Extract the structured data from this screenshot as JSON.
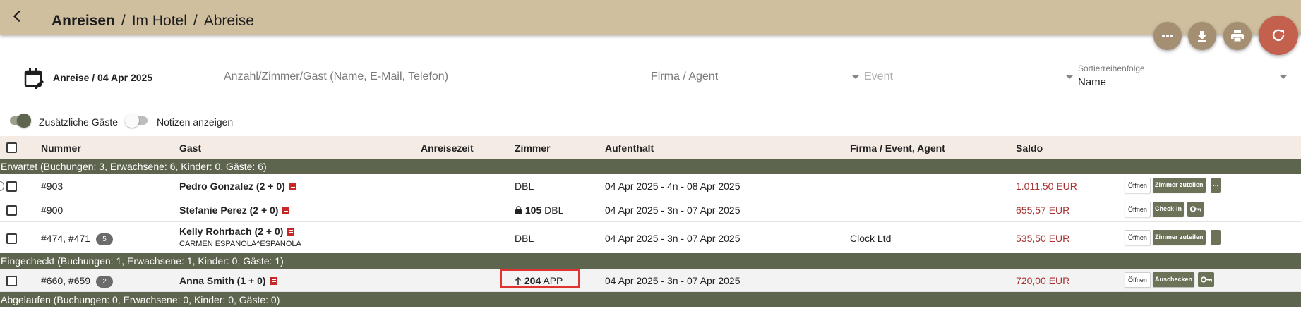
{
  "header": {
    "crumb_1": "Anreisen",
    "sep_1": "/",
    "crumb_2": "Im Hotel",
    "sep_2": "/",
    "crumb_3": "Abreise"
  },
  "actions": {
    "more": "more-icon",
    "download": "download-icon",
    "print": "print-icon",
    "refresh": "refresh-icon",
    "refresh_color": "#c4604e",
    "fab_color": "#a58f73"
  },
  "filters": {
    "arrival_label": "Anreise / 04 Apr 2025",
    "search_placeholder": "Anzahl/Zimmer/Gast (Name, E-Mail, Telefon)",
    "company_placeholder": "Firma / Agent",
    "event_placeholder": "Event",
    "sort_label": "Sortierreihenfolge",
    "sort_value": "Name"
  },
  "toggles": {
    "extra_guests": "Zusätzliche Gäste",
    "extra_guests_on": true,
    "show_notes": "Notizen anzeigen",
    "show_notes_on": false
  },
  "columns": {
    "number": "Nummer",
    "guest": "Gast",
    "arrival_time": "Anreisezeit",
    "room": "Zimmer",
    "stay": "Aufenthalt",
    "company": "Firma / Event, Agent",
    "balance": "Saldo"
  },
  "groups": {
    "expected": "Erwartet (Buchungen: 3, Erwachsene: 6, Kinder: 0, Gäste: 6)",
    "checked_in": "Eingecheckt (Buchungen: 1, Erwachsene: 1, Kinder: 0, Gäste: 1)",
    "expired": "Abgelaufen (Buchungen: 0, Erwachsene: 0, Kinder: 0, Gäste: 0)"
  },
  "rows": [
    {
      "number": "#903",
      "guest": "Pedro Gonzalez (2 + 0)",
      "room_no": "",
      "room_type": "DBL",
      "stay": "04 Apr 2025 - 4n - 08 Apr 2025",
      "company": "",
      "balance": "1.011,50 EUR",
      "btn_open": "Öffnen",
      "btn_action": "Zimmer zuteilen",
      "btn_more": "..."
    },
    {
      "number": "#900",
      "guest": "Stefanie Perez (2 + 0)",
      "room_no": "105",
      "room_type": "DBL",
      "stay": "04 Apr 2025 - 3n - 07 Apr 2025",
      "company": "",
      "balance": "655,57 EUR",
      "btn_open": "Öffnen",
      "btn_action": "Check-In"
    },
    {
      "number": "#474, #471",
      "badge": "5",
      "guest": "Kelly Rohrbach (2 + 0)",
      "sub": "CARMEN ESPANOLA^ESPANOLA",
      "room_no": "",
      "room_type": "DBL",
      "stay": "04 Apr 2025 - 3n - 07 Apr 2025",
      "company": "Clock Ltd",
      "balance": "535,50 EUR",
      "btn_open": "Öffnen",
      "btn_action": "Zimmer zuteilen",
      "btn_more": "..."
    },
    {
      "number": "#660, #659",
      "badge": "2",
      "guest": "Anna Smith (1 + 0)",
      "room_no": "204",
      "room_type": "APP",
      "stay": "04 Apr 2025 - 3n - 07 Apr 2025",
      "company": "",
      "balance": "720,00 EUR",
      "btn_open": "Öffnen",
      "btn_action": "Auschecken"
    }
  ]
}
